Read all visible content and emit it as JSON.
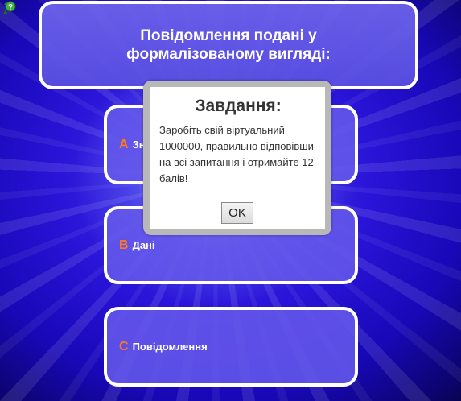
{
  "help_icon": "help-question-icon",
  "question": {
    "text": "Повідомлення подані у формалізованому вигляді:"
  },
  "answers": [
    {
      "letter": "A",
      "text": "Зн"
    },
    {
      "letter": "B",
      "text": "Дані"
    },
    {
      "letter": "C",
      "text": "Повідомлення"
    }
  ],
  "modal": {
    "title": "Завдання:",
    "body": "Заробіть свій віртуальний 1000000, правильно відповівши на всі запитання і отримайте 12 балів!",
    "ok_label": "OK"
  },
  "colors": {
    "answer_letter": "#ff7a1a",
    "panel": "#6458eb",
    "background": "#2a14d8"
  }
}
